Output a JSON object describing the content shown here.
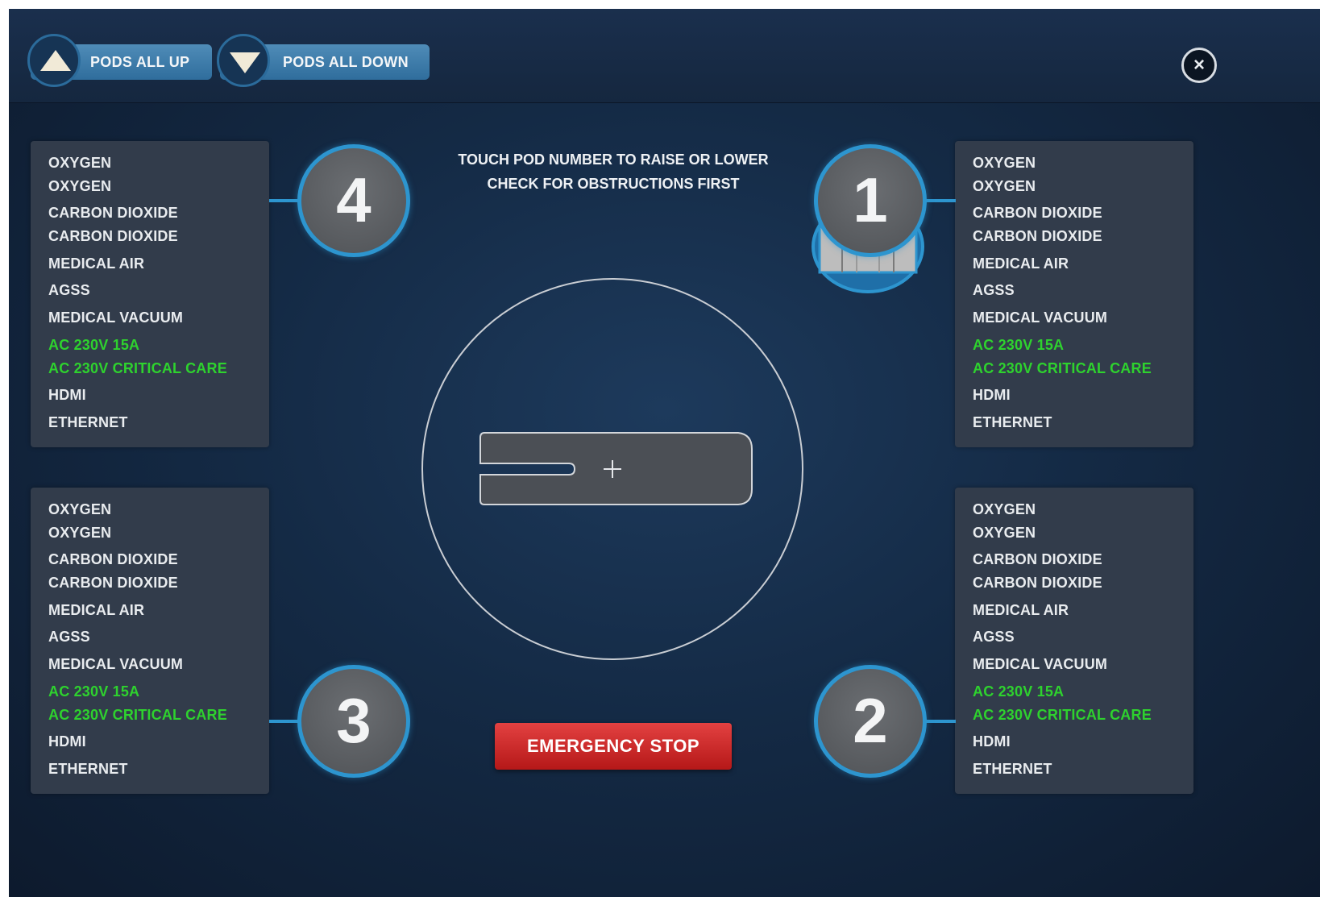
{
  "toolbar": {
    "pods_all_up_label": "PODS ALL UP",
    "pods_all_down_label": "PODS ALL DOWN",
    "close_icon": "close-circle-icon"
  },
  "instructions": {
    "line1": "TOUCH POD NUMBER TO RAISE OR LOWER",
    "line2": "CHECK FOR OBSTRUCTIONS FIRST"
  },
  "pods": [
    {
      "number": "4",
      "services": [
        "OXYGEN",
        "OXYGEN",
        "CARBON DIOXIDE",
        "CARBON DIOXIDE",
        "MEDICAL AIR",
        "AGSS",
        "MEDICAL VACUUM",
        "AC 230V 15A",
        "AC 230V  CRITICAL CARE",
        "HDMI",
        "ETHERNET"
      ]
    },
    {
      "number": "1",
      "state": "lowered",
      "services": [
        "OXYGEN",
        "OXYGEN",
        "CARBON DIOXIDE",
        "CARBON DIOXIDE",
        "MEDICAL AIR",
        "AGSS",
        "MEDICAL VACUUM",
        "AC 230V 15A",
        "AC 230V  CRITICAL CARE",
        "HDMI",
        "ETHERNET"
      ]
    },
    {
      "number": "3",
      "services": [
        "OXYGEN",
        "OXYGEN",
        "CARBON DIOXIDE",
        "CARBON DIOXIDE",
        "MEDICAL AIR",
        "AGSS",
        "MEDICAL VACUUM",
        "AC 230V 15A",
        "AC 230V  CRITICAL CARE",
        "HDMI",
        "ETHERNET"
      ]
    },
    {
      "number": "2",
      "services": [
        "OXYGEN",
        "OXYGEN",
        "CARBON DIOXIDE",
        "CARBON DIOXIDE",
        "MEDICAL AIR",
        "AGSS",
        "MEDICAL VACUUM",
        "AC 230V 15A",
        "AC 230V  CRITICAL CARE",
        "HDMI",
        "ETHERNET"
      ]
    }
  ],
  "emergency_stop_label": "EMERGENCY STOP",
  "colors": {
    "background": "#142a45",
    "accent_blue": "#2d95cf",
    "power_green": "#2ed22e",
    "emergency_red": "#d02828",
    "panel": "#323c4b"
  }
}
